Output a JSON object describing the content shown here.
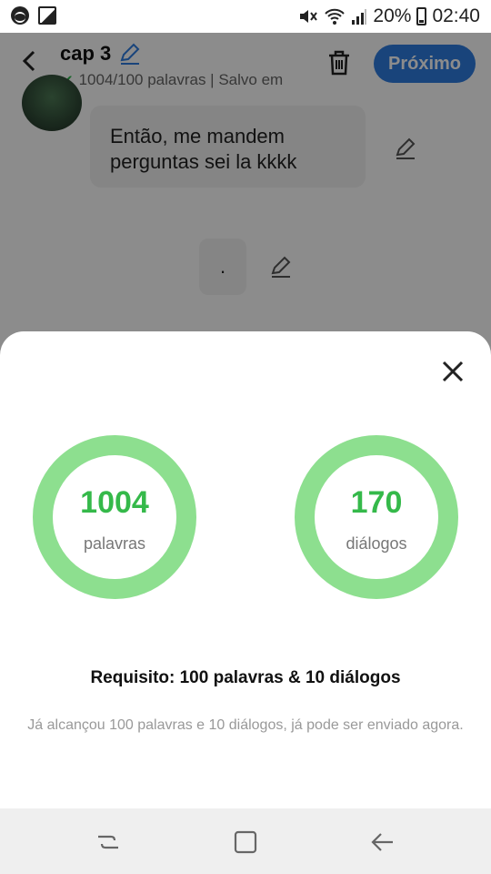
{
  "status": {
    "battery": "20%",
    "time": "02:40"
  },
  "header": {
    "title": "cap 3",
    "subtitle": "1004/100 palavras | Salvo em",
    "next_label": "Próximo"
  },
  "chat": {
    "message": "Então, me mandem perguntas sei la kkkk",
    "mini_message": "."
  },
  "stats": {
    "words_count": "1004",
    "words_label": "palavras",
    "dialogs_count": "170",
    "dialogs_label": "diálogos"
  },
  "requirement": "Requisito: 100 palavras & 10 diálogos",
  "description": "Já alcançou 100 palavras e 10 diálogos, já pode ser enviado agora.",
  "colors": {
    "accent": "#2f7de0",
    "ring": "#8ddf8f",
    "count": "#35b94a"
  }
}
